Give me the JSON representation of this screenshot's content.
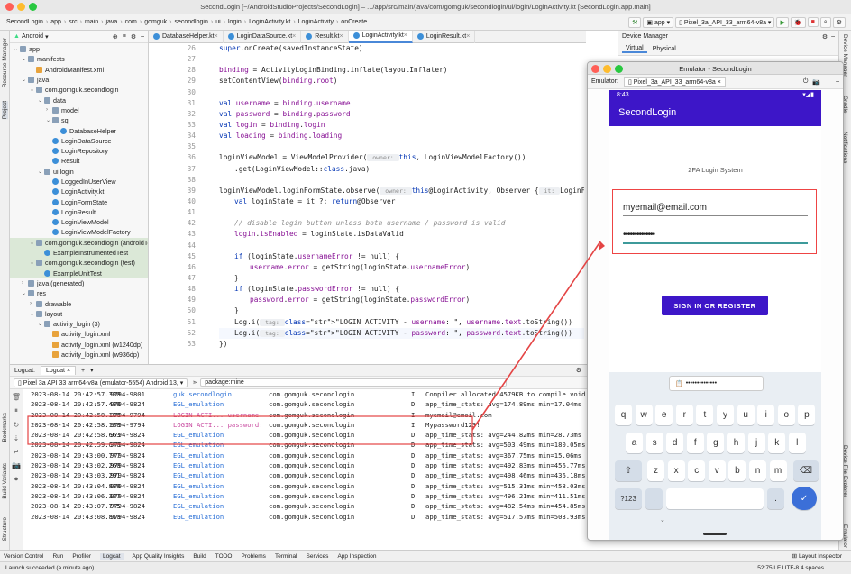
{
  "window_title": "SecondLogin [~/AndroidStudioProjects/SecondLogin] – .../app/src/main/java/com/gomguk/secondlogin/ui/login/LoginActivity.kt [SecondLogin.app.main]",
  "breadcrumbs": [
    "SecondLogin",
    "app",
    "src",
    "main",
    "java",
    "com",
    "gomguk",
    "secondlogin",
    "ui",
    "login",
    "LoginActivity.kt",
    "LoginActivity",
    "onCreate"
  ],
  "toolbar": {
    "run_config": "app",
    "device": "Pixel_3a_API_33_arm64-v8a"
  },
  "left_strip_labels": [
    "Resource Manager",
    "Project",
    "Bookmarks",
    "Build Variants",
    "Structure"
  ],
  "project": {
    "view_mode": "Android",
    "tree": [
      {
        "label": "app",
        "depth": 0,
        "icon": "folder",
        "open": true
      },
      {
        "label": "manifests",
        "depth": 1,
        "icon": "folder",
        "open": true
      },
      {
        "label": "AndroidManifest.xml",
        "depth": 2,
        "icon": "xml"
      },
      {
        "label": "java",
        "depth": 1,
        "icon": "folder",
        "open": true
      },
      {
        "label": "com.gomguk.secondlogin",
        "depth": 2,
        "icon": "folder",
        "open": true
      },
      {
        "label": "data",
        "depth": 3,
        "icon": "folder",
        "open": true
      },
      {
        "label": "model",
        "depth": 4,
        "icon": "folder",
        "open": false
      },
      {
        "label": "sql",
        "depth": 4,
        "icon": "folder",
        "open": true
      },
      {
        "label": "DatabaseHelper",
        "depth": 5,
        "icon": "class"
      },
      {
        "label": "LoginDataSource",
        "depth": 4,
        "icon": "class"
      },
      {
        "label": "LoginRepository",
        "depth": 4,
        "icon": "class"
      },
      {
        "label": "Result",
        "depth": 4,
        "icon": "class"
      },
      {
        "label": "ui.login",
        "depth": 3,
        "icon": "folder",
        "open": true
      },
      {
        "label": "LoggedInUserView",
        "depth": 4,
        "icon": "class"
      },
      {
        "label": "LoginActivity.kt",
        "depth": 4,
        "icon": "class"
      },
      {
        "label": "LoginFormState",
        "depth": 4,
        "icon": "class"
      },
      {
        "label": "LoginResult",
        "depth": 4,
        "icon": "class"
      },
      {
        "label": "LoginViewModel",
        "depth": 4,
        "icon": "class"
      },
      {
        "label": "LoginViewModelFactory",
        "depth": 4,
        "icon": "class"
      },
      {
        "label": "com.gomguk.secondlogin (androidTest)",
        "depth": 2,
        "icon": "folder",
        "open": true,
        "hl": true
      },
      {
        "label": "ExampleInstrumentedTest",
        "depth": 3,
        "icon": "class",
        "hl": true
      },
      {
        "label": "com.gomguk.secondlogin (test)",
        "depth": 2,
        "icon": "folder",
        "open": true,
        "hl": true
      },
      {
        "label": "ExampleUnitTest",
        "depth": 3,
        "icon": "class",
        "hl": true
      },
      {
        "label": "java (generated)",
        "depth": 1,
        "icon": "folder",
        "open": false
      },
      {
        "label": "res",
        "depth": 1,
        "icon": "folder",
        "open": true
      },
      {
        "label": "drawable",
        "depth": 2,
        "icon": "folder",
        "open": false
      },
      {
        "label": "layout",
        "depth": 2,
        "icon": "folder",
        "open": true
      },
      {
        "label": "activity_login (3)",
        "depth": 3,
        "icon": "folder",
        "open": true
      },
      {
        "label": "activity_login.xml",
        "depth": 4,
        "icon": "xml"
      },
      {
        "label": "activity_login.xml (w1240dp)",
        "depth": 4,
        "icon": "xml"
      },
      {
        "label": "activity_login.xml (w936dp)",
        "depth": 4,
        "icon": "xml"
      }
    ]
  },
  "editor_tabs": [
    {
      "label": "DatabaseHelper.kt",
      "active": false
    },
    {
      "label": "LoginDataSource.kt",
      "active": false
    },
    {
      "label": "Result.kt",
      "active": false
    },
    {
      "label": "LoginActivity.kt",
      "active": true
    },
    {
      "label": "LoginResult.kt",
      "active": false
    }
  ],
  "code_lines": [
    {
      "n": "26",
      "html": "super.onCreate(savedInstanceState)",
      "indent": 0
    },
    {
      "n": "27",
      "html": "",
      "indent": 0
    },
    {
      "n": "28",
      "html": "binding = ActivityLoginBinding.inflate(layoutInflater)",
      "indent": 0
    },
    {
      "n": "29",
      "html": "setContentView(binding.root)",
      "indent": 0
    },
    {
      "n": "30",
      "html": "",
      "indent": 0
    },
    {
      "n": "31",
      "html": "val username = binding.username",
      "indent": 0
    },
    {
      "n": "32",
      "html": "val password = binding.password",
      "indent": 0
    },
    {
      "n": "33",
      "html": "val login = binding.login",
      "indent": 0
    },
    {
      "n": "34",
      "html": "val loading = binding.loading",
      "indent": 0
    },
    {
      "n": "35",
      "html": "",
      "indent": 0
    },
    {
      "n": "36",
      "html": "loginViewModel = ViewModelProvider( owner: this, LoginViewModelFactory())",
      "indent": 0
    },
    {
      "n": "37",
      "html": ".get(LoginViewModel::class.java)",
      "indent": 1
    },
    {
      "n": "38",
      "html": "",
      "indent": 0
    },
    {
      "n": "39",
      "html": "loginViewModel.loginFormState.observe( owner: this@LoginActivity, Observer { it: LoginFormState!",
      "indent": 0
    },
    {
      "n": "40",
      "html": "val loginState = it ?: return@Observer",
      "indent": 1
    },
    {
      "n": "41",
      "html": "",
      "indent": 0
    },
    {
      "n": "42",
      "html": "// disable login button unless both username / password is valid",
      "indent": 1
    },
    {
      "n": "43",
      "html": "login.isEnabled = loginState.isDataValid",
      "indent": 1
    },
    {
      "n": "44",
      "html": "",
      "indent": 0
    },
    {
      "n": "45",
      "html": "if (loginState.usernameError != null) {",
      "indent": 1
    },
    {
      "n": "46",
      "html": "username.error = getString(loginState.usernameError)",
      "indent": 2
    },
    {
      "n": "47",
      "html": "}",
      "indent": 1
    },
    {
      "n": "48",
      "html": "if (loginState.passwordError != null) {",
      "indent": 1
    },
    {
      "n": "49",
      "html": "password.error = getString(loginState.passwordError)",
      "indent": 2
    },
    {
      "n": "50",
      "html": "}",
      "indent": 1
    },
    {
      "n": "51",
      "html": "Log.i( tag: \"LOGIN ACTIVITY - username: \", username.text.toString())",
      "indent": 1
    },
    {
      "n": "52",
      "html": "Log.i( tag: \"LOGIN ACTIVITY - password: \", password.text.toString())",
      "indent": 1
    },
    {
      "n": "53",
      "html": "})",
      "indent": 0
    }
  ],
  "logcat": {
    "tab_label": "Logcat",
    "panel_label": "Logcat:",
    "device": "Pixel 3a API 33 arm64-v8a (emulator-5554) Android 13,",
    "filter": "package:mine",
    "rows": [
      {
        "time": "2023-08-14 20:42:57.320",
        "pid": "9794-9801",
        "tag": "guk.secondlogin",
        "tagc": "blue",
        "pkg": "com.gomguk.secondlogin",
        "lvl": "I",
        "msg": "Compiler allocated 4579KB to compile void"
      },
      {
        "time": "2023-08-14 20:42:57.438",
        "pid": "9794-9824",
        "tag": "EGL_emulation",
        "tagc": "blue",
        "pkg": "com.gomguk.secondlogin",
        "lvl": "D",
        "msg": "app_time_stats: avg=174.89ms min=17.04ms"
      },
      {
        "time": "2023-08-14 20:42:58.128",
        "pid": "9794-9794",
        "tag": "LOGIN ACTI... username:",
        "tagc": "pink",
        "pkg": "com.gomguk.secondlogin",
        "lvl": "I",
        "msg": "myemail@email.com"
      },
      {
        "time": "2023-08-14 20:42:58.128",
        "pid": "9794-9794",
        "tag": "LOGIN ACTI... password:",
        "tagc": "pink",
        "pkg": "com.gomguk.secondlogin",
        "lvl": "I",
        "msg": "Mypassword123!"
      },
      {
        "time": "2023-08-14 20:42:58.663",
        "pid": "9794-9824",
        "tag": "EGL_emulation",
        "tagc": "blue",
        "pkg": "com.gomguk.secondlogin",
        "lvl": "D",
        "msg": "app_time_stats: avg=244.82ms min=28.73ms"
      },
      {
        "time": "2023-08-14 20:42:59.670",
        "pid": "9794-9824",
        "tag": "EGL_emulation",
        "tagc": "blue",
        "pkg": "com.gomguk.secondlogin",
        "lvl": "D",
        "msg": "app_time_stats: avg=503.49ms min=180.05ms"
      },
      {
        "time": "2023-08-14 20:43:00.777",
        "pid": "9794-9824",
        "tag": "EGL_emulation",
        "tagc": "blue",
        "pkg": "com.gomguk.secondlogin",
        "lvl": "D",
        "msg": "app_time_stats: avg=367.75ms min=15.06ms"
      },
      {
        "time": "2023-08-14 20:43:02.260",
        "pid": "9794-9824",
        "tag": "EGL_emulation",
        "tagc": "blue",
        "pkg": "com.gomguk.secondlogin",
        "lvl": "D",
        "msg": "app_time_stats: avg=492.83ms min=456.77ms"
      },
      {
        "time": "2023-08-14 20:43:03.291",
        "pid": "9794-9824",
        "tag": "EGL_emulation",
        "tagc": "blue",
        "pkg": "com.gomguk.secondlogin",
        "lvl": "D",
        "msg": "app_time_stats: avg=498.46ms min=436.18ms"
      },
      {
        "time": "2023-08-14 20:43:04.838",
        "pid": "9794-9824",
        "tag": "EGL_emulation",
        "tagc": "blue",
        "pkg": "com.gomguk.secondlogin",
        "lvl": "D",
        "msg": "app_time_stats: avg=515.31ms min=458.03ms"
      },
      {
        "time": "2023-08-14 20:43:06.327",
        "pid": "9794-9824",
        "tag": "EGL_emulation",
        "tagc": "blue",
        "pkg": "com.gomguk.secondlogin",
        "lvl": "D",
        "msg": "app_time_stats: avg=496.21ms min=411.51ms"
      },
      {
        "time": "2023-08-14 20:43:07.775",
        "pid": "9794-9824",
        "tag": "EGL_emulation",
        "tagc": "blue",
        "pkg": "com.gomguk.secondlogin",
        "lvl": "D",
        "msg": "app_time_stats: avg=482.54ms min=454.85ms"
      },
      {
        "time": "2023-08-14 20:43:08.810",
        "pid": "9794-9824",
        "tag": "EGL_emulation",
        "tagc": "blue",
        "pkg": "com.gomguk.secondlogin",
        "lvl": "D",
        "msg": "app_time_stats: avg=517.57ms min=503.93ms max=531.21ms count=2"
      }
    ]
  },
  "bottom_tools": [
    "Version Control",
    "Run",
    "Profiler",
    "Logcat",
    "App Quality Insights",
    "Build",
    "TODO",
    "Problems",
    "Terminal",
    "Services",
    "App Inspection"
  ],
  "layout_inspector": "Layout Inspector",
  "status": {
    "left": "Launch succeeded (a minute ago)",
    "right": "52:75  LF  UTF-8  4 spaces"
  },
  "device_manager": {
    "title": "Device Manager",
    "tabs": [
      "Virtual",
      "Physical"
    ]
  },
  "right_strip_labels": [
    "Device Manager",
    "Gradle",
    "Notifications",
    "Device File Explorer",
    "Emulator"
  ],
  "emulator": {
    "title": "Emulator - SecondLogin",
    "label": "Emulator:",
    "device": "Pixel_3a_API_33_arm64-v8a",
    "time": "8:43",
    "app_title": "SecondLogin",
    "hint": "2FA Login System",
    "email": "myemail@email.com",
    "password_dots": "••••••••••••••",
    "sign_in": "SIGN IN OR REGISTER",
    "suggestion": "••••••••••••••",
    "key_rows": [
      [
        "q",
        "w",
        "e",
        "r",
        "t",
        "y",
        "u",
        "i",
        "o",
        "p"
      ],
      [
        "a",
        "s",
        "d",
        "f",
        "g",
        "h",
        "j",
        "k",
        "l"
      ],
      [
        "z",
        "x",
        "c",
        "v",
        "b",
        "n",
        "m"
      ]
    ],
    "sym_key": "?123",
    "comma": ",",
    "period": "."
  },
  "colors": {
    "accent": "#3d16c8",
    "highlight": "#e44444"
  }
}
